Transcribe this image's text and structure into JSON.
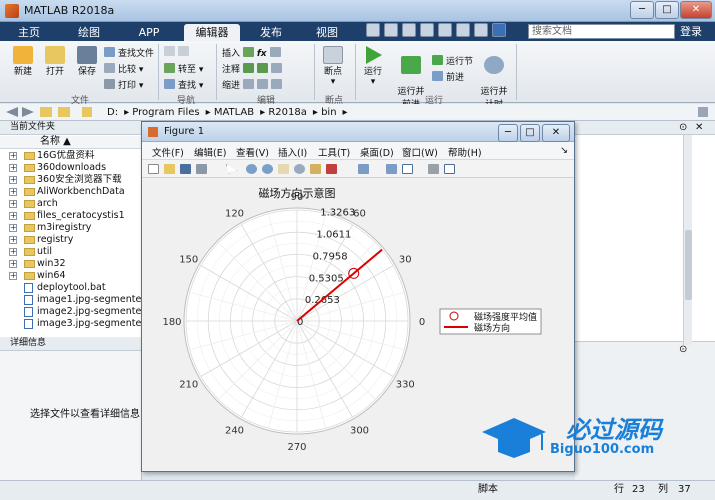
{
  "window": {
    "title": "MATLAB R2018a",
    "min": "─",
    "max": "□",
    "close": "✕"
  },
  "tabs": [
    "主页",
    "绘图",
    "APP",
    "编辑器",
    "发布",
    "视图"
  ],
  "active_tab": "编辑器",
  "search": {
    "placeholder": "搜索文档"
  },
  "login_label": "登录",
  "ribbon": {
    "file": {
      "new": "新建",
      "open": "打开",
      "save": "保存",
      "find_files": "查找文件",
      "compare": "比较",
      "print": "打印",
      "group": "文件"
    },
    "nav": {
      "goto": "转至",
      "find": "查找",
      "group": "导航"
    },
    "edit": {
      "insert": "插入",
      "comment": "注释",
      "indent": "缩进",
      "fx": "fx",
      "group": "编辑"
    },
    "breakpoints": {
      "label": "断点",
      "group": "断点"
    },
    "run": {
      "run": "运行",
      "run_advance": "运行并\n前进",
      "run_section": "运行节",
      "advance": "前进",
      "run_time": "运行并\n计时",
      "group": "运行"
    }
  },
  "path": [
    "D:",
    "Program Files",
    "MATLAB",
    "R2018a",
    "bin"
  ],
  "current_folder": {
    "title": "当前文件夹",
    "column": "名称 ▲",
    "items": [
      {
        "name": "16G优盘资料",
        "type": "folder"
      },
      {
        "name": "360downloads",
        "type": "folder"
      },
      {
        "name": "360安全浏览器下载",
        "type": "folder"
      },
      {
        "name": "AliWorkbenchData",
        "type": "folder"
      },
      {
        "name": "arch",
        "type": "folder"
      },
      {
        "name": "files_ceratocystis1",
        "type": "folder"
      },
      {
        "name": "m3iregistry",
        "type": "folder"
      },
      {
        "name": "registry",
        "type": "folder"
      },
      {
        "name": "util",
        "type": "folder"
      },
      {
        "name": "win32",
        "type": "folder"
      },
      {
        "name": "win64",
        "type": "folder"
      },
      {
        "name": "deploytool.bat",
        "type": "file"
      },
      {
        "name": "image1.jpg-segmente...",
        "type": "file"
      },
      {
        "name": "image2.jpg-segmente...",
        "type": "file"
      },
      {
        "name": "image3.jpg-segmente...",
        "type": "file"
      }
    ]
  },
  "details": {
    "title": "详细信息",
    "empty_text": "选择文件以查看详细信息"
  },
  "status": {
    "mode": "脚本",
    "row_label": "行",
    "row": "23",
    "col_label": "列",
    "col": "37"
  },
  "figure": {
    "title": "Figure 1",
    "menu": [
      "文件(F)",
      "编辑(E)",
      "查看(V)",
      "插入(I)",
      "工具(T)",
      "桌面(D)",
      "窗口(W)",
      "帮助(H)"
    ]
  },
  "chart_data": {
    "type": "polar",
    "title": "磁场方向示意图",
    "angle_ticks": [
      "0",
      "30",
      "60",
      "90",
      "120",
      "150",
      "180",
      "210",
      "240",
      "270",
      "300",
      "330"
    ],
    "radial_ticks": [
      "0",
      "0.2653",
      "0.5305",
      "0.7958",
      "1.0611",
      "1.3263"
    ],
    "rlim": [
      0,
      1.3263
    ],
    "series": [
      {
        "name": "磁场强度平均值",
        "style": "marker",
        "marker": "circle",
        "color": "#cc0000",
        "theta_deg": 40,
        "r": 0.885
      },
      {
        "name": "磁场方向",
        "style": "line",
        "color": "#dd0000",
        "theta_deg": [
          40,
          40
        ],
        "r": [
          0,
          1.326
        ]
      }
    ],
    "legend_position": "east"
  },
  "watermark": {
    "brand": "必过源码",
    "url": "Biguo100.com",
    "color": "#1a7fd8"
  }
}
